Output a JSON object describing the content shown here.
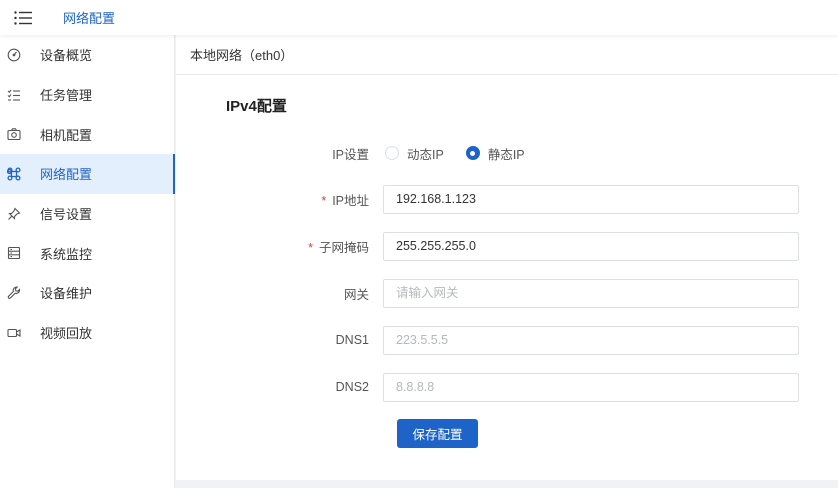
{
  "topbar": {
    "title": "网络配置",
    "menu_icon": "hamburger-menu-icon"
  },
  "sidebar": {
    "items": [
      {
        "label": "设备概览",
        "icon": "dashboard-gauge-icon"
      },
      {
        "label": "任务管理",
        "icon": "task-list-icon"
      },
      {
        "label": "相机配置",
        "icon": "camera-icon"
      },
      {
        "label": "网络配置",
        "icon": "command-key-icon",
        "active": true
      },
      {
        "label": "信号设置",
        "icon": "pin-icon"
      },
      {
        "label": "系统监控",
        "icon": "server-monitor-icon"
      },
      {
        "label": "设备维护",
        "icon": "wrench-icon"
      },
      {
        "label": "视频回放",
        "icon": "video-camera-icon"
      }
    ]
  },
  "main": {
    "section_title": "本地网络（eth0）",
    "form_title": "IPv4配置",
    "ip_setting": {
      "label": "IP设置",
      "options": [
        "动态IP",
        "静态IP"
      ],
      "selected": "静态IP"
    },
    "fields": {
      "ip": {
        "label": "IP地址",
        "value": "192.168.1.123",
        "required": "*"
      },
      "mask": {
        "label": "子网掩码",
        "value": "255.255.255.0",
        "required": "*"
      },
      "gateway": {
        "label": "网关",
        "value": "",
        "placeholder": "请输入网关"
      },
      "dns1": {
        "label": "DNS1",
        "value": "",
        "placeholder": "223.5.5.5"
      },
      "dns2": {
        "label": "DNS2",
        "value": "",
        "placeholder": "8.8.8.8"
      }
    },
    "save_label": "保存配置"
  },
  "colors": {
    "accent": "#1e63c8",
    "required": "#e0403a",
    "active_bg": "#e3effc"
  }
}
